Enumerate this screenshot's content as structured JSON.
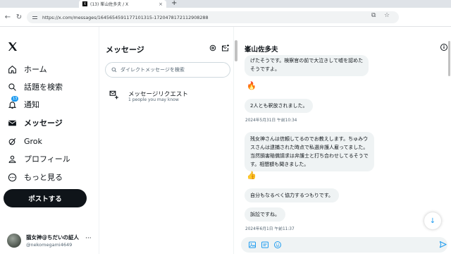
{
  "browser": {
    "tab_title": "(13) 峯山佐多夫 / X",
    "tab_favicon": "X",
    "new_tab": "+",
    "url": "https://x.com/messages/1645654591177101315-1720478172112908288"
  },
  "nav": {
    "items": [
      {
        "label": "ホーム",
        "icon": "home-icon"
      },
      {
        "label": "話題を検索",
        "icon": "search-icon"
      },
      {
        "label": "通知",
        "icon": "bell-icon",
        "badge": "13"
      },
      {
        "label": "メッセージ",
        "icon": "envelope-icon",
        "active": true
      },
      {
        "label": "Grok",
        "icon": "grok-icon"
      },
      {
        "label": "プロフィール",
        "icon": "person-icon"
      },
      {
        "label": "もっと見る",
        "icon": "more-circle-icon"
      }
    ],
    "post_button": "ポストする",
    "profile": {
      "name": "猫女神@ちだいの証人",
      "handle": "@nekomegami4649",
      "more": "···"
    }
  },
  "messages_panel": {
    "title": "メッセージ",
    "search_placeholder": "ダイレクトメッセージを検索",
    "request_title": "メッセージリクエスト",
    "request_subtitle": "1 people you may know"
  },
  "conversation": {
    "name": "峯山佐多夫",
    "messages": [
      {
        "kind": "text",
        "text": "げたそうです。検察官の前で大泣きして嘘を認めた\nそうですよ。"
      },
      {
        "kind": "emoji",
        "text": "🔥"
      },
      {
        "kind": "text",
        "text": "2人とも釈放されました。"
      },
      {
        "kind": "time",
        "text": "2024年5月31日 午前10:34"
      },
      {
        "kind": "text",
        "text": "残女神さんは信頼してるのでお教えします。ちゅみウ\nスさんは逮捕された時点で私選弁護人雇ってました。\n当然損害賠償請求は弁護士と打ち合わせしてるそうで\nす。相懇額も聞きました。"
      },
      {
        "kind": "emoji",
        "text": "👍"
      },
      {
        "kind": "text",
        "text": "自分もなるべく協力するつもりです。"
      },
      {
        "kind": "text",
        "text": "訴訟ですね。"
      },
      {
        "kind": "time",
        "text": "2024年6月1日 午前11:37"
      }
    ]
  },
  "colors": {
    "accent": "#1d9bf0",
    "bubble": "#eff3f4",
    "text": "#0f1419",
    "muted": "#536471"
  }
}
